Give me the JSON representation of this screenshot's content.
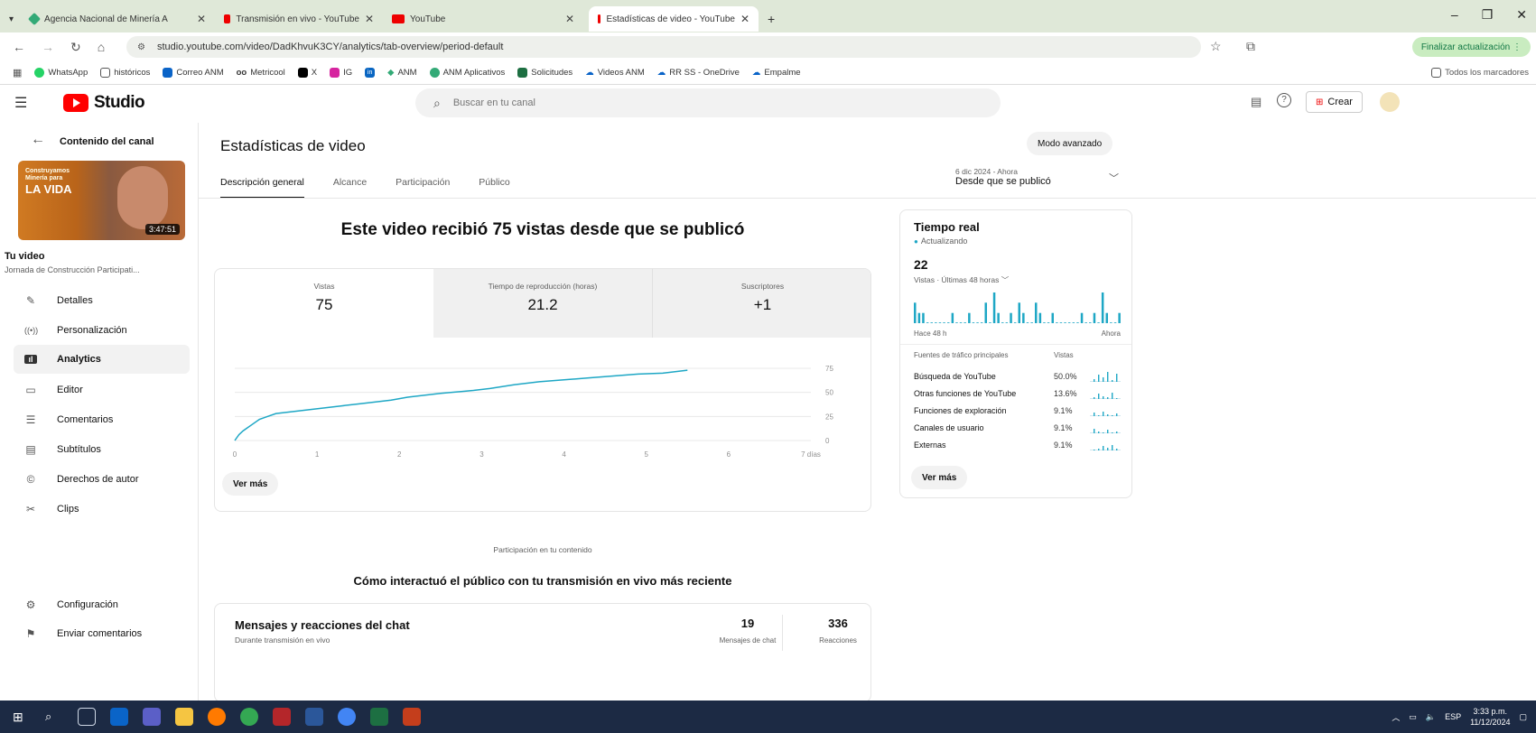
{
  "browser": {
    "tabs": [
      {
        "label": "Agencia Nacional de Minería A",
        "active": false
      },
      {
        "label": "Transmisión en vivo - YouTube",
        "active": false
      },
      {
        "label": "YouTube",
        "active": false
      },
      {
        "label": "Estadísticas de video - YouTube",
        "active": true
      }
    ],
    "url": "studio.youtube.com/video/DadKhvuK3CY/analytics/tab-overview/period-default",
    "update_label": "Finalizar actualización",
    "bookmarks": [
      "WhatsApp",
      "históricos",
      "Correo ANM",
      "Metricool",
      "X",
      "IG",
      "in",
      "ANM",
      "ANM Aplicativos",
      "Solicitudes",
      "Videos ANM",
      "RR SS - OneDrive",
      "Empalme"
    ],
    "all_bookmarks": "Todos los marcadores"
  },
  "header": {
    "logo_text": "Studio",
    "search_placeholder": "Buscar en tu canal",
    "create_label": "Crear"
  },
  "sidebar": {
    "title": "Contenido del canal",
    "thumb_line1": "Construyamos",
    "thumb_line2": "Minería para",
    "thumb_big": "LA VIDA",
    "thumb_duration": "3:47:51",
    "your_video": "Tu video",
    "video_title": "Jornada de Construcción Participati...",
    "items": [
      {
        "label": "Detalles",
        "icon": "pencil-icon"
      },
      {
        "label": "Personalización",
        "icon": "broadcast-icon"
      },
      {
        "label": "Analytics",
        "icon": "analytics-icon",
        "selected": true
      },
      {
        "label": "Editor",
        "icon": "film-icon"
      },
      {
        "label": "Comentarios",
        "icon": "comment-icon"
      },
      {
        "label": "Subtítulos",
        "icon": "subtitles-icon"
      },
      {
        "label": "Derechos de autor",
        "icon": "copyright-icon"
      },
      {
        "label": "Clips",
        "icon": "scissors-icon"
      }
    ],
    "bottom_items": [
      {
        "label": "Configuración",
        "icon": "gear-icon"
      },
      {
        "label": "Enviar comentarios",
        "icon": "feedback-icon"
      }
    ]
  },
  "main": {
    "title": "Estadísticas de video",
    "mode_button": "Modo avanzado",
    "period_date": "6 dic 2024 - Ahora",
    "period_label": "Desde que se publicó",
    "tabs": [
      "Descripción general",
      "Alcance",
      "Participación",
      "Público"
    ],
    "headline": "Este video recibió 75 vistas desde que se publicó",
    "metrics": [
      {
        "label": "Vistas",
        "value": "75"
      },
      {
        "label": "Tiempo de reproducción (horas)",
        "value": "21.2"
      },
      {
        "label": "Suscriptores",
        "value": "+1"
      }
    ],
    "see_more": "Ver más"
  },
  "chart_data": {
    "type": "line",
    "x": [
      0,
      0.05,
      0.1,
      0.15,
      0.2,
      0.3,
      0.4,
      0.5,
      0.7,
      0.9,
      1.1,
      1.3,
      1.5,
      1.7,
      1.9,
      2.1,
      2.3,
      2.5,
      2.9,
      3.1,
      3.4,
      3.7,
      4.0,
      4.3,
      4.6,
      4.9,
      5.2,
      5.5
    ],
    "y": [
      0,
      6,
      10,
      13,
      16,
      22,
      25,
      28,
      30,
      32,
      34,
      36,
      38,
      40,
      42,
      45,
      47,
      49,
      52,
      54,
      58,
      61,
      63,
      65,
      67,
      69,
      70,
      73
    ],
    "xticks": [
      "0",
      "1",
      "2",
      "3",
      "4",
      "5",
      "6",
      "7 días"
    ],
    "yticks": [
      "0",
      "25",
      "50",
      "75"
    ],
    "xlim": [
      0,
      7
    ],
    "ylim": [
      0,
      75
    ],
    "color": "#1ea7c5",
    "grid": true
  },
  "realtime": {
    "title": "Tiempo real",
    "status": "Actualizando",
    "count": "22",
    "subtitle": "Vistas · Últimas 48 horas",
    "bars": [
      2,
      1,
      1,
      0,
      0,
      0,
      0,
      0,
      0,
      1,
      0,
      0,
      0,
      1,
      0,
      0,
      0,
      2,
      0,
      3,
      1,
      0,
      0,
      1,
      0,
      2,
      1,
      0,
      0,
      2,
      1,
      0,
      0,
      1,
      0,
      0,
      0,
      0,
      0,
      0,
      1,
      0,
      0,
      1,
      0,
      3,
      1,
      0,
      0,
      1
    ],
    "label_left": "Hace 48 h",
    "label_right": "Ahora",
    "sources_header": "Fuentes de tráfico principales",
    "sources_col": "Vistas",
    "sources": [
      {
        "name": "Búsqueda de YouTube",
        "pct": "50.0%"
      },
      {
        "name": "Otras funciones de YouTube",
        "pct": "13.6%"
      },
      {
        "name": "Funciones de exploración",
        "pct": "9.1%"
      },
      {
        "name": "Canales de usuario",
        "pct": "9.1%"
      },
      {
        "name": "Externas",
        "pct": "9.1%"
      }
    ],
    "see_more": "Ver más"
  },
  "engagement": {
    "label": "Participación en tu contenido",
    "headline": "Cómo interactuó el público con tu transmisión en vivo más reciente",
    "card_title": "Mensajes y reacciones del chat",
    "card_sub": "Durante transmisión en vivo",
    "messages_value": "19",
    "messages_label": "Mensajes de chat",
    "reactions_value": "336",
    "reactions_label": "Reacciones"
  },
  "taskbar": {
    "lang": "ESP",
    "time": "3:33 p.m.",
    "date": "11/12/2024"
  }
}
